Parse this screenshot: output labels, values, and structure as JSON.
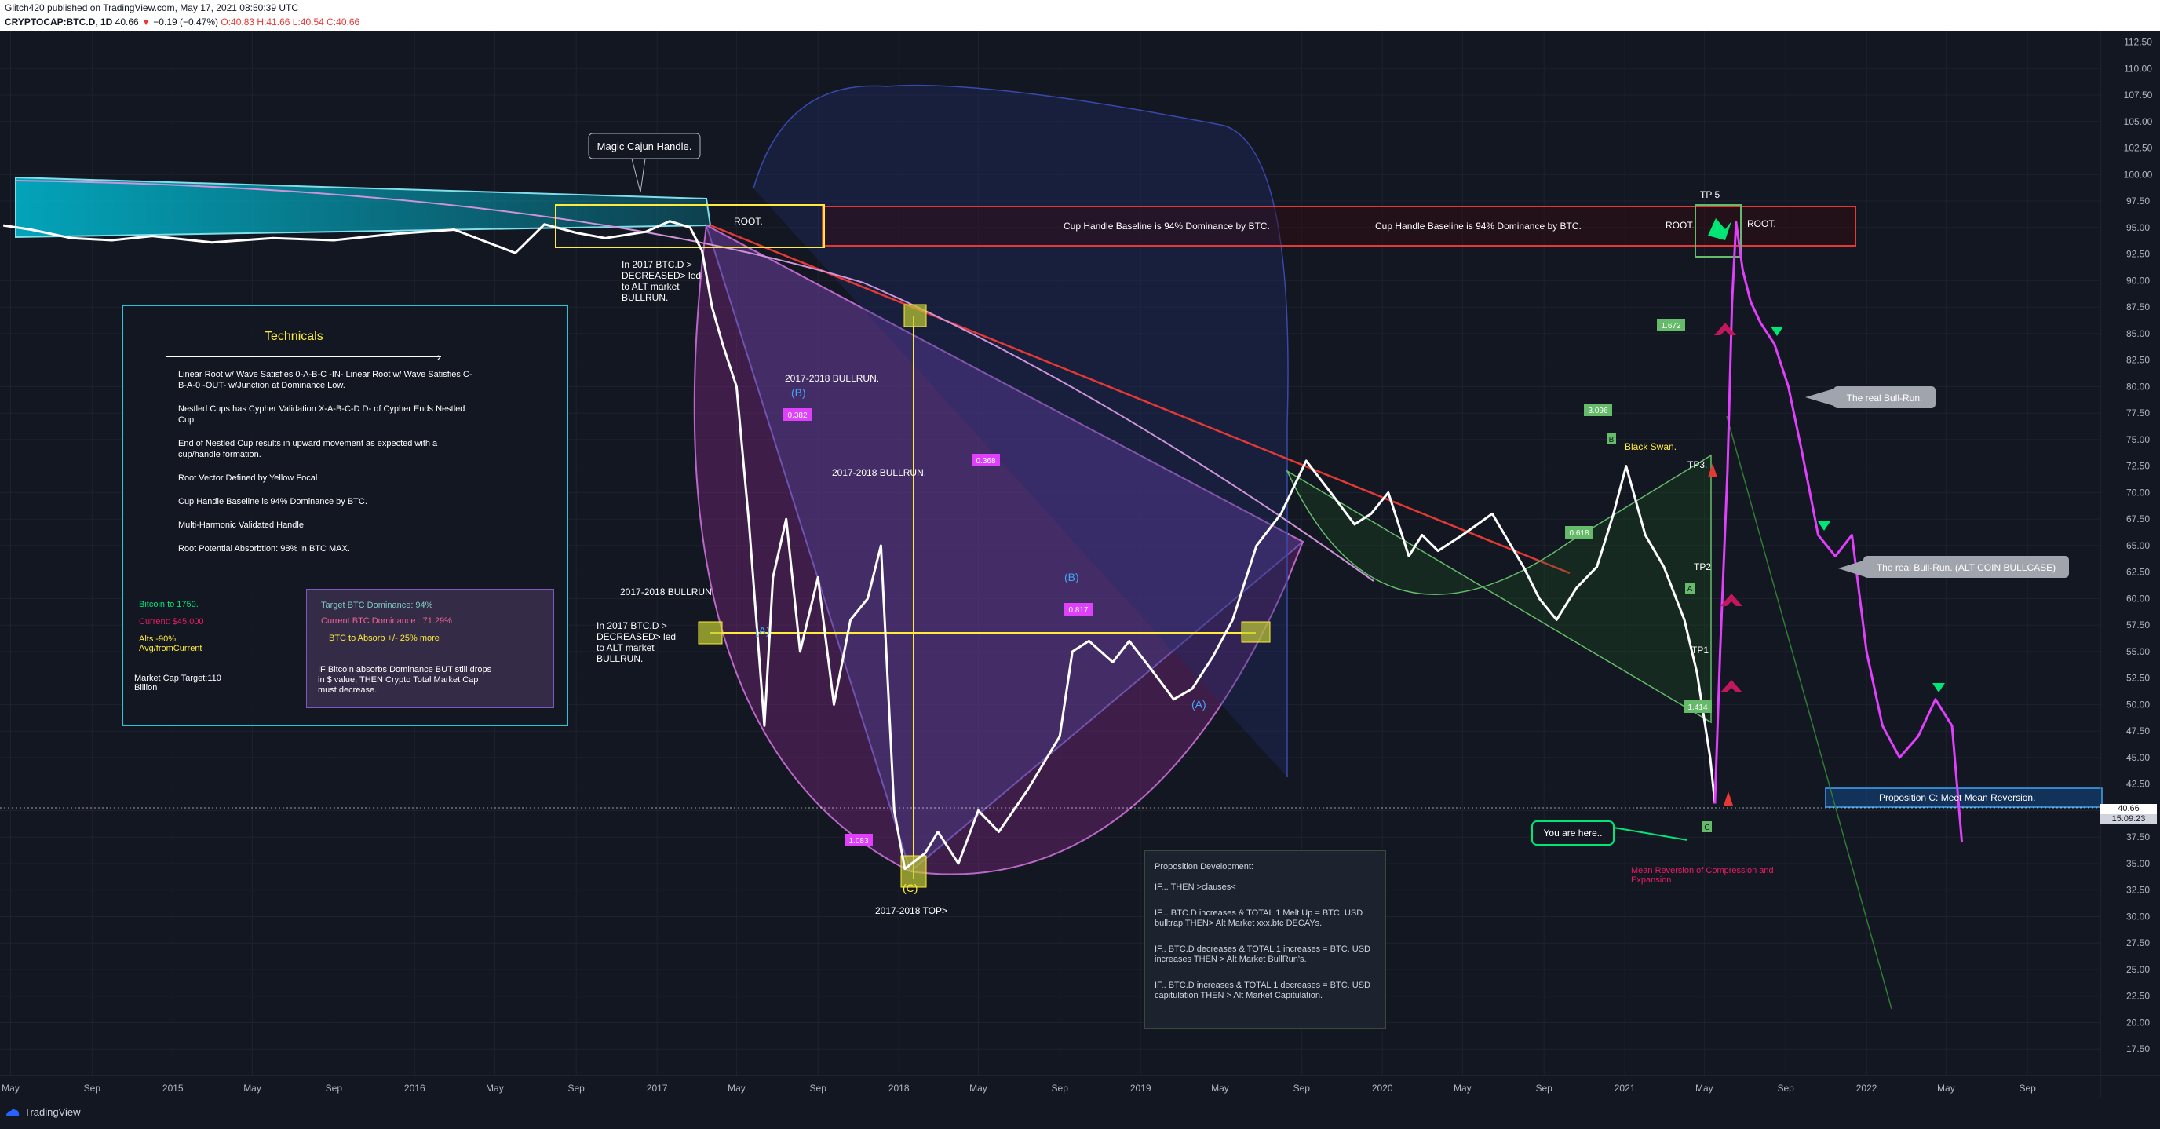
{
  "header": {
    "line1": "Glitch420 published on TradingView.com, May 17, 2021 08:50:39 UTC",
    "symbol": "CRYPTOCAP:BTC.D, 1D",
    "last": "40.66",
    "change": "−0.19 (−0.47%)",
    "ohlc": "O:40.83 H:41.66 L:40.54 C:40.66"
  },
  "footer": {
    "brand": "TradingView"
  },
  "price_tag": {
    "price": "40.66",
    "countdown": "15:09:23"
  },
  "colors": {
    "background": "#131722",
    "price_line": "#ffffff",
    "pink_line": "#e040fb",
    "red_line": "#e53935",
    "cyan": "#26c6da",
    "yellow": "#ffeb3b",
    "purple_fill": "#9c27b0",
    "blue_fill": "#3f51b5"
  },
  "chart_data": {
    "type": "line",
    "title": "",
    "xlabel": "",
    "ylabel": "",
    "ylim": [
      15,
      113.5
    ],
    "x_range": [
      "2014-04-15",
      "2022-12-20"
    ],
    "y_ticks": [
      112.5,
      110.0,
      107.5,
      105.0,
      102.5,
      100.0,
      97.5,
      95.0,
      92.5,
      90.0,
      87.5,
      85.0,
      82.5,
      80.0,
      77.5,
      75.0,
      72.5,
      70.0,
      67.5,
      65.0,
      62.5,
      60.0,
      57.5,
      55.0,
      52.5,
      50.0,
      47.5,
      45.0,
      42.5,
      40.0,
      37.5,
      35.0,
      32.5,
      30.0,
      27.5,
      25.0,
      22.5,
      20.0,
      17.5
    ],
    "x_ticks": [
      {
        "date": "2014-05-01",
        "label": "May"
      },
      {
        "date": "2014-09-01",
        "label": "Sep"
      },
      {
        "date": "2015-01-01",
        "label": "2015"
      },
      {
        "date": "2015-05-01",
        "label": "May"
      },
      {
        "date": "2015-09-01",
        "label": "Sep"
      },
      {
        "date": "2016-01-01",
        "label": "2016"
      },
      {
        "date": "2016-05-01",
        "label": "May"
      },
      {
        "date": "2016-09-01",
        "label": "Sep"
      },
      {
        "date": "2017-01-01",
        "label": "2017"
      },
      {
        "date": "2017-05-01",
        "label": "May"
      },
      {
        "date": "2017-09-01",
        "label": "Sep"
      },
      {
        "date": "2018-01-01",
        "label": "2018"
      },
      {
        "date": "2018-05-01",
        "label": "May"
      },
      {
        "date": "2018-09-01",
        "label": "Sep"
      },
      {
        "date": "2019-01-01",
        "label": "2019"
      },
      {
        "date": "2019-05-01",
        "label": "May"
      },
      {
        "date": "2019-09-01",
        "label": "Sep"
      },
      {
        "date": "2020-01-01",
        "label": "2020"
      },
      {
        "date": "2020-05-01",
        "label": "May"
      },
      {
        "date": "2020-09-01",
        "label": "Sep"
      },
      {
        "date": "2021-01-01",
        "label": "2021"
      },
      {
        "date": "2021-05-01",
        "label": "May"
      },
      {
        "date": "2021-09-01",
        "label": "Sep"
      },
      {
        "date": "2022-01-01",
        "label": "2022"
      },
      {
        "date": "2022-05-01",
        "label": "May"
      },
      {
        "date": "2022-09-01",
        "label": "Sep"
      }
    ],
    "series": [
      {
        "color": "#ffffff",
        "points": [
          [
            "2014-04-20",
            95.2
          ],
          [
            "2014-06-01",
            94.8
          ],
          [
            "2014-08-01",
            94.0
          ],
          [
            "2014-10-01",
            93.8
          ],
          [
            "2014-12-01",
            94.2
          ],
          [
            "2015-03-01",
            93.6
          ],
          [
            "2015-06-01",
            94.0
          ],
          [
            "2015-09-01",
            93.8
          ],
          [
            "2015-12-01",
            94.4
          ],
          [
            "2016-03-01",
            94.8
          ],
          [
            "2016-06-01",
            92.6
          ],
          [
            "2016-07-15",
            95.3
          ],
          [
            "2016-09-01",
            94.5
          ],
          [
            "2016-10-15",
            94.0
          ],
          [
            "2016-12-15",
            94.6
          ],
          [
            "2017-01-20",
            95.6
          ],
          [
            "2017-02-20",
            95.0
          ],
          [
            "2017-03-10",
            92.8
          ],
          [
            "2017-03-25",
            87.5
          ],
          [
            "2017-04-10",
            84.0
          ],
          [
            "2017-05-01",
            80.0
          ],
          [
            "2017-05-20",
            67.0
          ],
          [
            "2017-06-12",
            48.0
          ],
          [
            "2017-06-25",
            62.0
          ],
          [
            "2017-07-15",
            67.5
          ],
          [
            "2017-08-05",
            55.0
          ],
          [
            "2017-09-01",
            62.0
          ],
          [
            "2017-09-25",
            50.0
          ],
          [
            "2017-10-20",
            58.0
          ],
          [
            "2017-11-15",
            60.0
          ],
          [
            "2017-12-05",
            65.0
          ],
          [
            "2017-12-25",
            40.0
          ],
          [
            "2018-01-10",
            34.5
          ],
          [
            "2018-02-10",
            36.0
          ],
          [
            "2018-03-01",
            38.0
          ],
          [
            "2018-04-01",
            35.0
          ],
          [
            "2018-05-01",
            40.0
          ],
          [
            "2018-06-01",
            38.0
          ],
          [
            "2018-07-15",
            42.0
          ],
          [
            "2018-09-01",
            47.0
          ],
          [
            "2018-09-20",
            55.0
          ],
          [
            "2018-10-15",
            56.0
          ],
          [
            "2018-11-20",
            54.0
          ],
          [
            "2018-12-15",
            56.0
          ],
          [
            "2019-01-15",
            53.5
          ],
          [
            "2019-02-20",
            50.5
          ],
          [
            "2019-03-20",
            51.5
          ],
          [
            "2019-04-20",
            54.5
          ],
          [
            "2019-05-20",
            58.0
          ],
          [
            "2019-06-25",
            65.0
          ],
          [
            "2019-08-01",
            68.0
          ],
          [
            "2019-09-08",
            73.0
          ],
          [
            "2019-10-15",
            70.0
          ],
          [
            "2019-11-20",
            67.0
          ],
          [
            "2019-12-15",
            68.0
          ],
          [
            "2020-01-10",
            70.0
          ],
          [
            "2020-02-10",
            64.0
          ],
          [
            "2020-03-01",
            66.0
          ],
          [
            "2020-03-25",
            64.5
          ],
          [
            "2020-05-01",
            66.0
          ],
          [
            "2020-06-15",
            68.0
          ],
          [
            "2020-08-01",
            63.0
          ],
          [
            "2020-08-25",
            60.0
          ],
          [
            "2020-09-20",
            58.0
          ],
          [
            "2020-10-20",
            61.0
          ],
          [
            "2020-11-20",
            63.0
          ],
          [
            "2020-12-15",
            68.0
          ],
          [
            "2021-01-03",
            72.5
          ],
          [
            "2021-02-01",
            66.0
          ],
          [
            "2021-03-01",
            63.0
          ],
          [
            "2021-04-01",
            58.0
          ],
          [
            "2021-04-20",
            53.0
          ],
          [
            "2021-05-10",
            45.0
          ],
          [
            "2021-05-17",
            40.66
          ]
        ]
      },
      {
        "color": "#e040fb",
        "points": [
          [
            "2021-05-17",
            40.66
          ],
          [
            "2021-05-25",
            55.0
          ],
          [
            "2021-06-05",
            72.0
          ],
          [
            "2021-06-12",
            88.0
          ],
          [
            "2021-06-18",
            95.5
          ],
          [
            "2021-06-28",
            91.0
          ],
          [
            "2021-07-10",
            88.0
          ],
          [
            "2021-07-25",
            86.0
          ],
          [
            "2021-08-15",
            84.0
          ],
          [
            "2021-09-05",
            80.0
          ],
          [
            "2021-09-25",
            74.0
          ],
          [
            "2021-10-20",
            66.0
          ],
          [
            "2021-11-15",
            64.0
          ],
          [
            "2021-12-10",
            66.0
          ],
          [
            "2022-01-01",
            55.0
          ],
          [
            "2022-01-25",
            48.0
          ],
          [
            "2022-02-20",
            45.0
          ],
          [
            "2022-03-20",
            47.0
          ],
          [
            "2022-04-15",
            50.5
          ],
          [
            "2022-05-10",
            48.0
          ],
          [
            "2022-05-25",
            37.0
          ]
        ]
      }
    ],
    "annotations": [
      "Magic Cajun Handle.",
      "ROOT.",
      "In 2017 BTC.D > DECREASED> led to ALT market BULLRUN.",
      "Cup Handle Baseline is 94% Dominance by BTC.",
      "2017-2018 BULLRUN.",
      "2017-2018 TOP>",
      "TP 5",
      "TP3.",
      "TP2",
      "TP1",
      "Black Swan.",
      "The real Bull-Run.",
      "The real Bull-Run. (ALT COIN BULLCASE)",
      "You are here..",
      "Mean Reversion of Compression and Expansion",
      "Proposition C: Meet Mean Reversion."
    ],
    "wave_labels": [
      "(B)",
      "(A)",
      "(C)",
      "(B)",
      "(A)",
      "A",
      "C",
      "B"
    ],
    "ratio_labels": [
      "0.382",
      "0.368",
      "1.083",
      "1.672",
      "3.096",
      "0.618",
      "1.414",
      "0.817"
    ],
    "technicals": {
      "title": "Technicals",
      "lines": [
        "Linear Root w/ Wave Satisfies 0-A-B-C -IN- Linear Root w/ Wave Satisfies C-B-A-0 -OUT- w/Junction at Dominance Low.",
        "Nestled Cups has Cypher Validation X-A-B-C-D D- of Cypher Ends Nestled Cup.",
        "End of Nestled Cup results in upward movement as expected with a cup/handle formation.",
        "Root Vector Defined by Yellow Focal",
        "Cup Handle Baseline is 94% Dominance by BTC.",
        "Multi-Harmonic Validated Handle",
        "Root Potential Absorbtion: 98% in BTC MAX."
      ],
      "left_items": [
        "Bitcoin to 1750.",
        "Current: $45,000",
        "Alts -90% Avg/fromCurrent",
        "Market Cap Target:110 Billion"
      ],
      "right_items": [
        "Target BTC Dominance: 94%",
        "Current BTC Dominance : 71.29%",
        "BTC to Absorb +/- 25% more",
        "IF Bitcoin absorbs Dominance BUT still drops in $ value, THEN Crypto Total Market Cap must decrease."
      ]
    },
    "proposition": {
      "title": "Proposition Development:",
      "lines": [
        "IF... THEN >clauses<",
        "IF... BTC.D increases & TOTAL 1 Melt Up = BTC. USD bulltrap THEN> Alt Market xxx.btc DECAYs.",
        "IF.. BTC.D decreases & TOTAL 1 increases = BTC. USD increases THEN > Alt Market BullRun's.",
        "IF.. BTC.D increases & TOTAL 1 decreases = BTC. USD capitulation THEN > Alt Market Capitulation."
      ]
    }
  }
}
